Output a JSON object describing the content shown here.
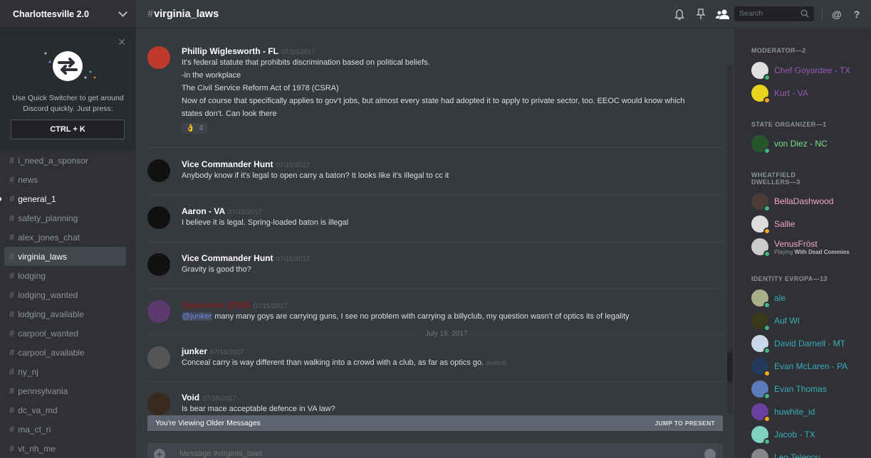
{
  "server": {
    "name": "Charlottesville 2.0"
  },
  "quick_switcher": {
    "text": "Use Quick Switcher to get around Discord quickly. Just press:",
    "shortcut": "CTRL + K"
  },
  "channels": [
    {
      "name": "i_need_a_sponsor",
      "state": "normal"
    },
    {
      "name": "news",
      "state": "normal"
    },
    {
      "name": "general_1",
      "state": "unread"
    },
    {
      "name": "safety_planning",
      "state": "normal"
    },
    {
      "name": "alex_jones_chat",
      "state": "normal"
    },
    {
      "name": "virginia_laws",
      "state": "active"
    },
    {
      "name": "lodging",
      "state": "normal"
    },
    {
      "name": "lodging_wanted",
      "state": "normal"
    },
    {
      "name": "lodging_available",
      "state": "normal"
    },
    {
      "name": "carpool_wanted",
      "state": "normal"
    },
    {
      "name": "carpool_available",
      "state": "normal"
    },
    {
      "name": "ny_nj",
      "state": "normal"
    },
    {
      "name": "pennsylvania",
      "state": "normal"
    },
    {
      "name": "dc_va_md",
      "state": "normal"
    },
    {
      "name": "ma_ct_ri",
      "state": "normal"
    },
    {
      "name": "vt_nh_me",
      "state": "normal"
    }
  ],
  "header": {
    "hash": "#",
    "channel": "virginia_laws",
    "search_placeholder": "Search",
    "at_symbol": "@",
    "help_symbol": "?"
  },
  "messages": [
    {
      "author": "Phillip Wiglesworth - FL",
      "author_color": "#ffffff",
      "timestamp": "07/15/2017",
      "avatar_color": "#c0392b",
      "lines": [
        "It's federal statute that prohibits discrimination based on political beliefs.",
        "-in the workplace",
        "The Civil Service Reform Act of 1978 (CSRA)",
        "Now of course that specifically applies to gov't jobs, but almost every state had adopted it to apply to private sector, too. EEOC would know which",
        "states don't. Can look there"
      ],
      "reaction": {
        "emoji": "👌",
        "count": "4"
      }
    },
    {
      "author": "Vice Commander Hunt",
      "author_color": "#ffffff",
      "timestamp": "07/15/2017",
      "avatar_color": "#111111",
      "lines": [
        "Anybody know if it's legal to open carry a baton? It looks like it's illegal to cc it"
      ]
    },
    {
      "author": "Aaron - VA",
      "author_color": "#ffffff",
      "timestamp": "07/15/2017",
      "avatar_color": "#111111",
      "lines": [
        "I believe it is legal. Spring-loaded baton is illegal"
      ]
    },
    {
      "author": "Vice Commander Hunt",
      "author_color": "#ffffff",
      "timestamp": "07/15/2017",
      "avatar_color": "#111111",
      "lines": [
        "Gravity is good tho?"
      ]
    },
    {
      "author": "Spaceman (DSB)",
      "author_color": "#7a1f1f",
      "timestamp": "07/15/2017",
      "avatar_color": "#5b3a6e",
      "mention": "@junker",
      "lines": [
        "many many goys are carrying guns, I see no problem with carrying a billyclub, my question wasn't of optics its of legality"
      ]
    },
    {
      "author": "junker",
      "author_color": "#ffffff",
      "timestamp": "07/16/2017",
      "avatar_color": "#555555",
      "lines": [
        "Conceal carry is way different than walking into a crowd with a club, as far as optics go."
      ],
      "edited": "(edited)"
    },
    {
      "author": "Void",
      "author_color": "#ffffff",
      "timestamp": "07/16/2017",
      "avatar_color": "#3a2a1e",
      "lines": [
        "Is bear mace acceptable defence in VA law?"
      ]
    }
  ],
  "date_divider": "July 16, 2017",
  "older_bar": {
    "text": "You're Viewing Older Messages",
    "jump": "JUMP TO PRESENT"
  },
  "composer": {
    "placeholder": "Message #virginia_laws"
  },
  "members": {
    "roles": [
      {
        "name": "MODERATOR—2",
        "members": [
          {
            "name": "Chef Goyardee - TX",
            "color": "#9b59b6",
            "avatar": "#e0e0e0",
            "status": "#43b581"
          },
          {
            "name": "Kurt - VA",
            "color": "#9b59b6",
            "avatar": "#e8d21e",
            "status": "#faa61a"
          }
        ]
      },
      {
        "name": "STATE ORGANIZER—1",
        "members": [
          {
            "name": "von Diez - NC",
            "color": "#7ee08a",
            "avatar": "#27562d",
            "status": "#43b581"
          }
        ]
      },
      {
        "name": "WHEATFIELD DWELLERS—3",
        "members": [
          {
            "name": "BellaDashwood",
            "color": "#f5a6c9",
            "avatar": "#4a3b36",
            "status": "#43b581"
          },
          {
            "name": "Sallie",
            "color": "#f5a6c9",
            "avatar": "#dddddd",
            "status": "#faa61a"
          },
          {
            "name": "VenusFröst",
            "color": "#f5a6c9",
            "avatar": "#cccccc",
            "status": "#43b581",
            "game_prefix": "Playing",
            "game": "With Dead Commies"
          }
        ]
      },
      {
        "name": "IDENTITY EVROPA—13",
        "members": [
          {
            "name": "ale",
            "color": "#3aaeb8",
            "avatar": "#a8b08a",
            "status": "#43b581"
          },
          {
            "name": "Auf WI",
            "color": "#3aaeb8",
            "avatar": "#3a3a1a",
            "status": "#43b581"
          },
          {
            "name": "David Darnell - MT",
            "color": "#3aaeb8",
            "avatar": "#c9d7e6",
            "status": "#43b581"
          },
          {
            "name": "Evan McLaren - PA",
            "color": "#3aaeb8",
            "avatar": "#243a5a",
            "status": "#faa61a"
          },
          {
            "name": "Evan Thomas",
            "color": "#3aaeb8",
            "avatar": "#5a7ab8",
            "status": "#43b581"
          },
          {
            "name": "huwhite_id",
            "color": "#3aaeb8",
            "avatar": "#6b3fa0",
            "status": "#faa61a"
          },
          {
            "name": "Jacob - TX",
            "color": "#3aaeb8",
            "avatar": "#7fd0c0",
            "status": "#43b581"
          },
          {
            "name": "Leo Telegov",
            "color": "#3aaeb8",
            "avatar": "#888888",
            "status": "#43b581"
          }
        ]
      }
    ]
  }
}
